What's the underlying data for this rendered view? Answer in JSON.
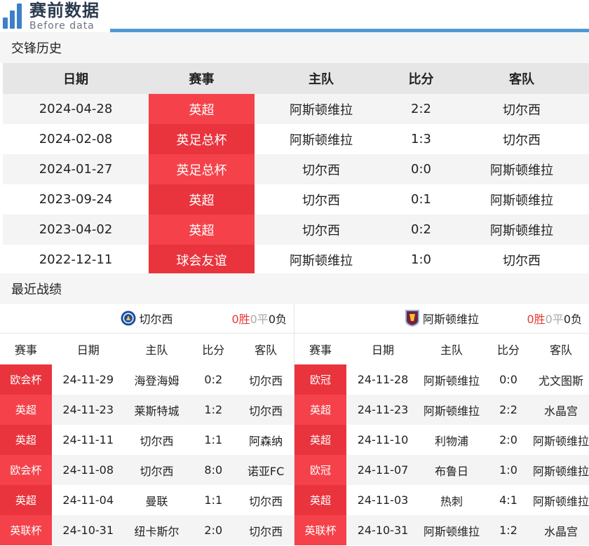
{
  "logo": {
    "cn": "赛前数据",
    "en": "Before data"
  },
  "h2h": {
    "title": "交锋历史",
    "headers": {
      "date": "日期",
      "comp": "赛事",
      "home": "主队",
      "score": "比分",
      "away": "客队"
    },
    "rows": [
      {
        "date": "2024-04-28",
        "comp": "英超",
        "home": "阿斯顿维拉",
        "score": "2:2",
        "away": "切尔西"
      },
      {
        "date": "2024-02-08",
        "comp": "英足总杯",
        "home": "阿斯顿维拉",
        "score": "1:3",
        "away": "切尔西"
      },
      {
        "date": "2024-01-27",
        "comp": "英足总杯",
        "home": "切尔西",
        "score": "0:0",
        "away": "阿斯顿维拉"
      },
      {
        "date": "2023-09-24",
        "comp": "英超",
        "home": "切尔西",
        "score": "0:1",
        "away": "阿斯顿维拉"
      },
      {
        "date": "2023-04-02",
        "comp": "英超",
        "home": "切尔西",
        "score": "0:2",
        "away": "阿斯顿维拉"
      },
      {
        "date": "2022-12-11",
        "comp": "球会友谊",
        "home": "阿斯顿维拉",
        "score": "1:0",
        "away": "切尔西"
      }
    ]
  },
  "recent": {
    "title": "最近战绩",
    "headers": {
      "comp": "赛事",
      "date": "日期",
      "home": "主队",
      "score": "比分",
      "away": "客队"
    },
    "left": {
      "team": "切尔西",
      "badge_icon": "chelsea-badge-icon",
      "win": "0胜",
      "draw": "0平",
      "loss": "0负",
      "rows": [
        {
          "comp": "欧会杯",
          "date": "24-11-29",
          "home": "海登海姆",
          "score": "0:2",
          "away": "切尔西"
        },
        {
          "comp": "英超",
          "date": "24-11-23",
          "home": "莱斯特城",
          "score": "1:2",
          "away": "切尔西"
        },
        {
          "comp": "英超",
          "date": "24-11-11",
          "home": "切尔西",
          "score": "1:1",
          "away": "阿森纳"
        },
        {
          "comp": "欧会杯",
          "date": "24-11-08",
          "home": "切尔西",
          "score": "8:0",
          "away": "诺亚FC"
        },
        {
          "comp": "英超",
          "date": "24-11-04",
          "home": "曼联",
          "score": "1:1",
          "away": "切尔西"
        },
        {
          "comp": "英联杯",
          "date": "24-10-31",
          "home": "纽卡斯尔",
          "score": "2:0",
          "away": "切尔西"
        }
      ]
    },
    "right": {
      "team": "阿斯顿维拉",
      "badge_icon": "aston-villa-badge-icon",
      "win": "0胜",
      "draw": "0平",
      "loss": "0负",
      "rows": [
        {
          "comp": "欧冠",
          "date": "24-11-28",
          "home": "阿斯顿维拉",
          "score": "0:0",
          "away": "尤文图斯"
        },
        {
          "comp": "英超",
          "date": "24-11-23",
          "home": "阿斯顿维拉",
          "score": "2:2",
          "away": "水晶宫"
        },
        {
          "comp": "英超",
          "date": "24-11-10",
          "home": "利物浦",
          "score": "2:0",
          "away": "阿斯顿维拉"
        },
        {
          "comp": "欧冠",
          "date": "24-11-07",
          "home": "布鲁日",
          "score": "1:0",
          "away": "阿斯顿维拉"
        },
        {
          "comp": "英超",
          "date": "24-11-03",
          "home": "热刺",
          "score": "4:1",
          "away": "阿斯顿维拉"
        },
        {
          "comp": "英联杯",
          "date": "24-10-31",
          "home": "阿斯顿维拉",
          "score": "1:2",
          "away": "水晶宫"
        }
      ]
    }
  },
  "colors": {
    "accent_blue": "#4f9ad6",
    "comp_red_light": "#f5424a",
    "comp_red_dark": "#e9343d",
    "win_red": "#e53935"
  }
}
